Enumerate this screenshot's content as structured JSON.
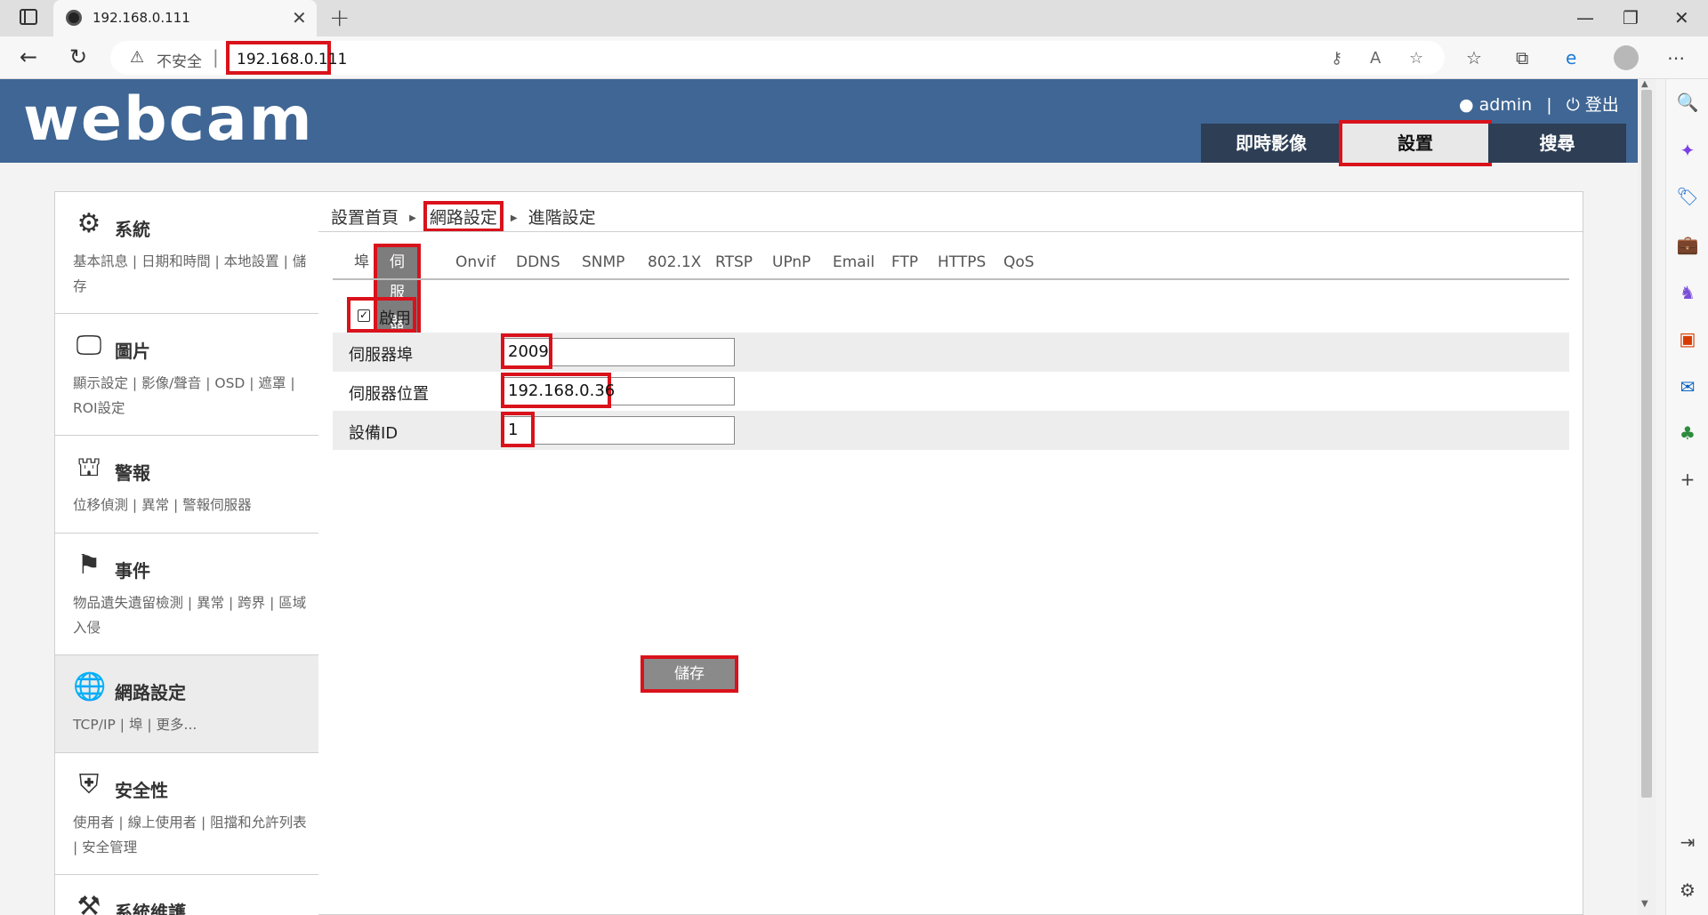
{
  "browser": {
    "tab_title": "192.168.0.111",
    "new_tab": "+",
    "close_tab": "✕",
    "window_minimize": "—",
    "window_restore": "❐",
    "window_close": "✕",
    "insecure_label": "不安全",
    "url": "192.168.0.111"
  },
  "header": {
    "logo": "webcam",
    "user": "admin",
    "separator": "|",
    "logout": "登出",
    "tabs": [
      {
        "label": "即時影像"
      },
      {
        "label": "設置"
      },
      {
        "label": "搜尋"
      }
    ]
  },
  "menu": [
    {
      "title": "系統",
      "links": "基本訊息 | 日期和時間 | 本地設置 | 儲存",
      "icon": "gear-icon"
    },
    {
      "title": "圖片",
      "links": "顯示設定 | 影像/聲音 | OSD | 遮罩 | ROI設定",
      "icon": "image-settings-icon"
    },
    {
      "title": "警報",
      "links": "位移偵測 | 異常 | 警報伺服器",
      "icon": "alarm-icon"
    },
    {
      "title": "事件",
      "links": "物品遺失遺留檢測 | 異常 | 跨界 | 區域入侵",
      "icon": "event-icon"
    },
    {
      "title": "網路設定",
      "links": "TCP/IP | 埠 | 更多...",
      "icon": "globe-icon"
    },
    {
      "title": "安全性",
      "links": "使用者 | 線上使用者 | 阻擋和允許列表 | 安全管理",
      "icon": "security-icon"
    },
    {
      "title": "系統維護",
      "links": "",
      "icon": "tools-icon"
    }
  ],
  "breadcrumb": {
    "home": "設置首頁",
    "section": "網路設定",
    "current": "進階設定"
  },
  "subtabs": [
    "埠",
    "伺服器",
    "Onvif",
    "DDNS",
    "SNMP",
    "802.1X",
    "RTSP",
    "UPnP",
    "Email",
    "FTP",
    "HTTPS",
    "QoS"
  ],
  "form": {
    "enable_label": "啟用",
    "enable_checked": true,
    "check_mark": "✓",
    "rows": [
      {
        "label": "伺服器埠",
        "value": "2009"
      },
      {
        "label": "伺服器位置",
        "value": "192.168.0.36"
      },
      {
        "label": "設備ID",
        "value": "1"
      }
    ],
    "save_label": "儲存"
  },
  "colors": {
    "header_bg": "#3f6694",
    "tab_dark": "#2d3e55",
    "highlight_red": "#d9121b"
  }
}
